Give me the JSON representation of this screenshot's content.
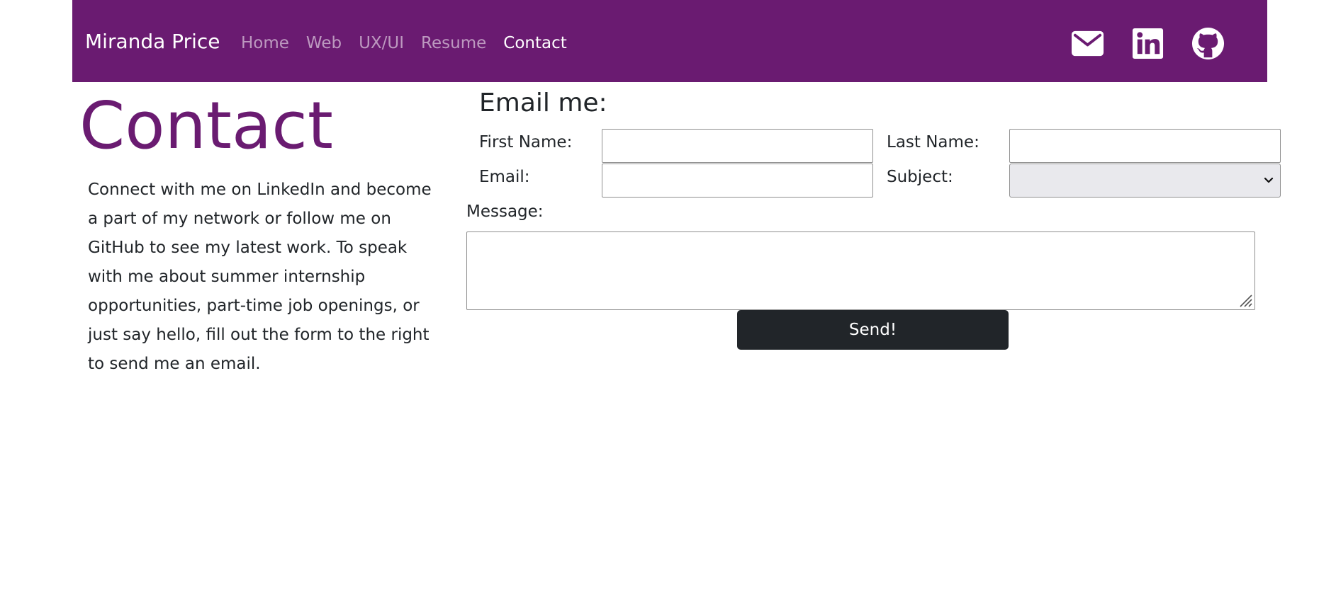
{
  "colors": {
    "nav_bg": "#6a1b71",
    "accent": "#6a1b71",
    "button_bg": "#212529",
    "text": "#212529"
  },
  "navbar": {
    "brand": "Miranda Price",
    "links": [
      {
        "label": "Home",
        "active": false
      },
      {
        "label": "Web",
        "active": false
      },
      {
        "label": "UX/UI",
        "active": false
      },
      {
        "label": "Resume",
        "active": false
      },
      {
        "label": "Contact",
        "active": true
      }
    ],
    "icons": [
      "mail-icon",
      "linkedin-icon",
      "github-icon"
    ]
  },
  "main": {
    "heading": "Contact",
    "intro": "Connect with me on LinkedIn and become a part of my network or follow me on GitHub to see my latest work. To speak with me about summer internship opportunities, part-time job openings, or just say hello, fill out the form to the right to send me an email."
  },
  "form": {
    "title": "Email me:",
    "first_name_label": "First Name:",
    "first_name_value": "",
    "last_name_label": "Last Name:",
    "last_name_value": "",
    "email_label": "Email:",
    "email_value": "",
    "subject_label": "Subject:",
    "subject_value": "",
    "message_label": "Message:",
    "message_value": "",
    "send_label": "Send!"
  }
}
